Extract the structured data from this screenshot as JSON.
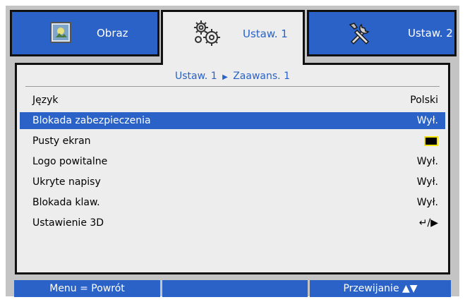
{
  "tabs": [
    {
      "label": "Obraz",
      "icon": "image-icon"
    },
    {
      "label": "Ustaw. 1",
      "icon": "gears-icon",
      "active": true
    },
    {
      "label": "Ustaw. 2",
      "icon": "tools-icon"
    }
  ],
  "breadcrumb": {
    "part1": "Ustaw. 1",
    "separator": "▶",
    "part2": "Zaawans. 1"
  },
  "rows": [
    {
      "label": "Język",
      "value": "Polski"
    },
    {
      "label": "Blokada zabezpieczenia",
      "value": "Wył.",
      "selected": true
    },
    {
      "label": "Pusty ekran",
      "value": ""
    },
    {
      "label": "Logo powitalne",
      "value": "Wył."
    },
    {
      "label": "Ukryte napisy",
      "value": "Wył."
    },
    {
      "label": "Blokada klaw.",
      "value": "Wył."
    },
    {
      "label": "Ustawienie 3D",
      "value": "↵/▶"
    }
  ],
  "footer": {
    "left": "Menu = Powrót",
    "middle": "",
    "right": "Przewijanie ▲▼"
  },
  "colors": {
    "accent": "#2a62c7",
    "panel": "#ededed",
    "frame": "#c4c4c4",
    "swatch_fill": "#000000",
    "swatch_border": "#f2e40a"
  }
}
